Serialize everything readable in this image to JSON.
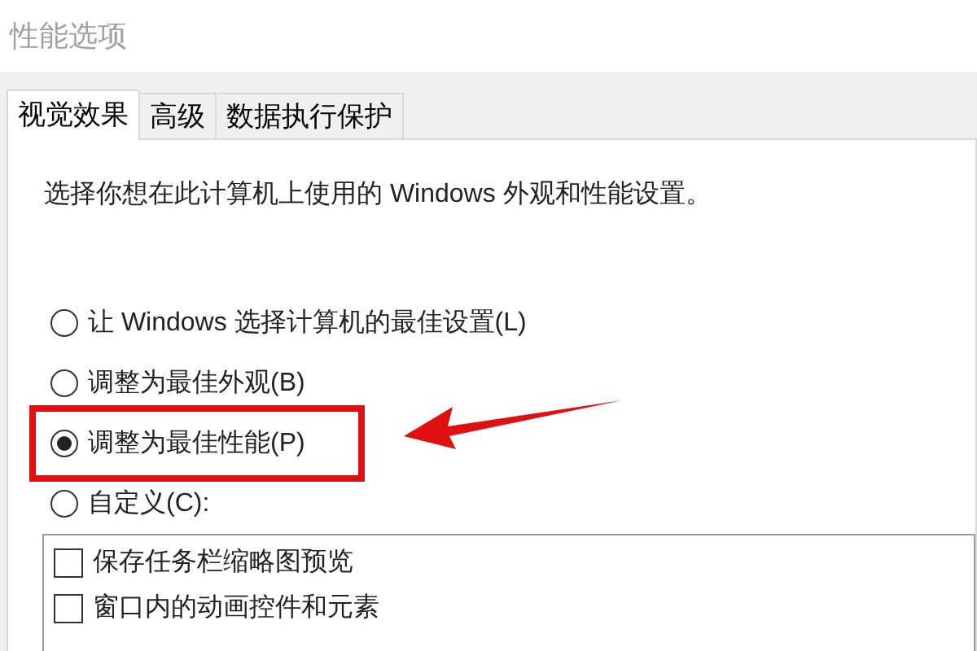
{
  "window": {
    "title": "性能选项"
  },
  "tabs": [
    {
      "label": "视觉效果",
      "selected": true
    },
    {
      "label": "高级",
      "selected": false
    },
    {
      "label": "数据执行保护",
      "selected": false
    }
  ],
  "description": "选择你想在此计算机上使用的 Windows 外观和性能设置。",
  "options": [
    {
      "label": "让 Windows 选择计算机的最佳设置(L)",
      "selected": false
    },
    {
      "label": "调整为最佳外观(B)",
      "selected": false
    },
    {
      "label": "调整为最佳性能(P)",
      "selected": true
    },
    {
      "label": "自定义(C):",
      "selected": false
    }
  ],
  "effects": [
    {
      "label": "保存任务栏缩略图预览",
      "checked": false
    },
    {
      "label": "窗口内的动画控件和元素",
      "checked": false
    }
  ]
}
